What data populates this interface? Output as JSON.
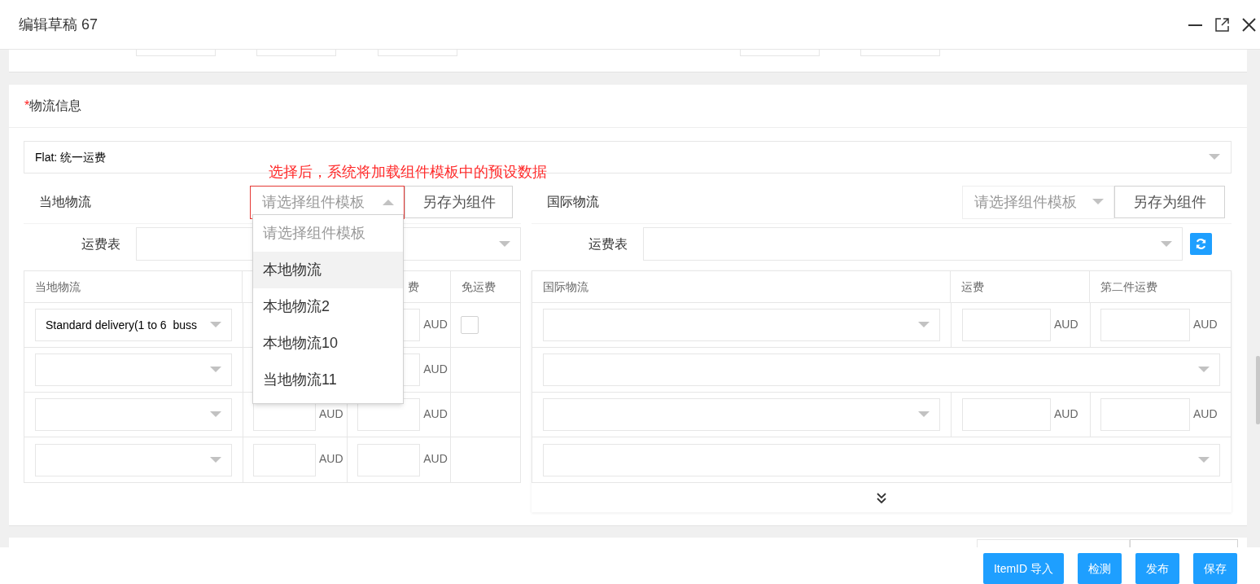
{
  "window": {
    "title": "编辑草稿 67"
  },
  "logistics": {
    "title": "物流信息",
    "required_mark": "*",
    "shipping_type": "Flat: 统一运费",
    "annotation": "选择后，系统将加载组件模板中的预设数据",
    "local": {
      "title": "当地物流",
      "template_placeholder": "请选择组件模板",
      "expanded": true,
      "save_button": "另存为组件",
      "rate_table_label": "运费表",
      "dropdown": [
        {
          "label": "请选择组件模板",
          "kind": "placeholder",
          "highlighted": false
        },
        {
          "label": "本地物流",
          "kind": "option",
          "highlighted": true
        },
        {
          "label": "本地物流2",
          "kind": "option",
          "highlighted": false
        },
        {
          "label": "本地物流10",
          "kind": "option",
          "highlighted": false
        },
        {
          "label": "当地物流11",
          "kind": "option",
          "highlighted": false
        }
      ],
      "columns": [
        {
          "label": "当地物流"
        },
        {},
        {
          "label": "费"
        },
        {
          "label": "免运费"
        }
      ],
      "rows": [
        {
          "service": "Standard delivery(1 to 6  buss",
          "second_currency": "AUD",
          "free_shipping": {
            "checked": false
          }
        },
        {
          "second_currency": "AUD"
        },
        {
          "currency": "AUD",
          "second_currency": "AUD"
        },
        {
          "currency": "AUD",
          "second_currency": "AUD"
        }
      ]
    },
    "international": {
      "title": "国际物流",
      "template_placeholder": "请选择组件模板",
      "expanded": false,
      "save_button": "另存为组件",
      "rate_table_label": "运费表",
      "columns": [
        {
          "label": "国际物流"
        },
        {
          "label": "运费"
        },
        {
          "label": "第二件运费"
        }
      ],
      "rows": [
        {
          "kind": "priced",
          "currency": "AUD",
          "second_currency": "AUD"
        },
        {
          "kind": "service_only"
        },
        {
          "kind": "priced",
          "currency": "AUD",
          "second_currency": "AUD"
        },
        {
          "kind": "service_only"
        }
      ]
    }
  },
  "footer_buttons": [
    "ItemID 导入",
    "检测",
    "发布",
    "保存"
  ]
}
